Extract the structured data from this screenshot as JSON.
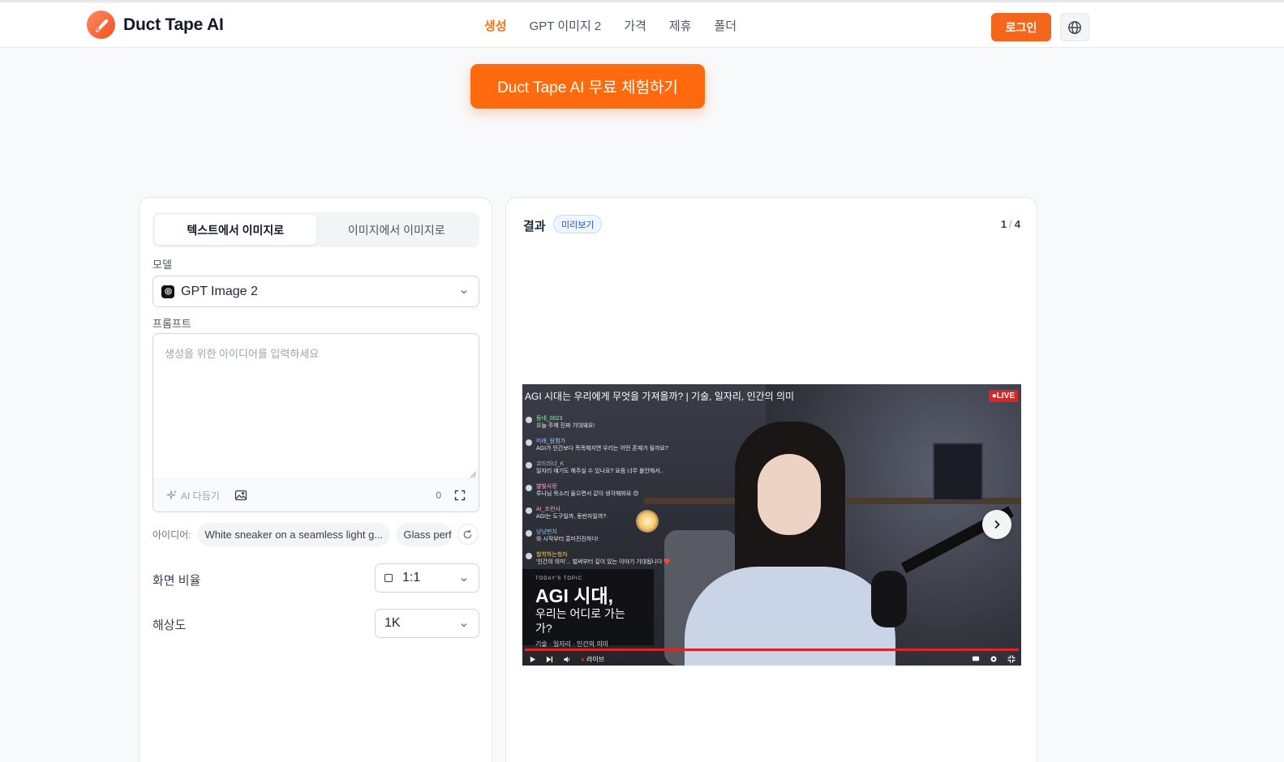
{
  "header": {
    "brand": "Duct Tape AI",
    "nav": [
      "생성",
      "GPT 이미지 2",
      "가격",
      "제휴",
      "폴더"
    ],
    "active_nav": 0,
    "login_label": "로그인",
    "accent_color": "#f97316"
  },
  "cta": {
    "label": "Duct Tape AI 무료 체험하기"
  },
  "generator": {
    "tabs": [
      "텍스트에서 이미지로",
      "이미지에서 이미지로"
    ],
    "active_tab": 0,
    "model_label": "모델",
    "model_value": "GPT Image 2",
    "prompt_label": "프롬프트",
    "prompt_placeholder": "생성을 위한 아이디어를 입력하세요",
    "ai_polish_label": "AI 다듬기",
    "char_count": "0",
    "ideas_label": "아이디어:",
    "ideas": [
      "White sneaker on a seamless light g...",
      "Glass perf"
    ],
    "aspect_label": "화면 비율",
    "aspect_value": "1:1",
    "resolution_label": "해상도",
    "resolution_value": "1K"
  },
  "result": {
    "title": "결과",
    "badge": "미리보기",
    "page_current": "1",
    "page_total": "4",
    "preview": {
      "video_title": "AGI 시대는 우리에게 무엇을 가져올까? | 기술, 일자리, 인간의 의미",
      "live_badge": "●LIVE",
      "chat": [
        {
          "name": "동네_0023",
          "msg": "오늘 주제 진짜 기대돼요!",
          "color": "#86efac"
        },
        {
          "name": "미래_탐험가",
          "msg": "AGI가 인간보다 똑똑해지면 우리는 어떤 존재가 될까요?",
          "color": "#93c5fd"
        },
        {
          "name": "코드러너_K",
          "msg": "일자리 얘기도 해주실 수 있나요? 요즘 너무 불안해서..",
          "color": "#93c5fd"
        },
        {
          "name": "별빛사랑",
          "msg": "루나님 목소리 들으면서 같이 생각해봐요 😊",
          "color": "#f9a8d4"
        },
        {
          "name": "AI_조련사",
          "msg": "AGI는 도구일까, 동반자일까?",
          "color": "#fca5a5"
        },
        {
          "name": "냥냥펀치",
          "msg": "와 시작부터 흥미진진하다!",
          "color": "#93c5fd"
        },
        {
          "name": "철학하는청자",
          "msg": "'인간의 의미'... 벌써부터 깊이 있는 이야기 기대됩니다 ❤️",
          "color": "#fcd34d"
        }
      ],
      "topic_kicker": "TODAY'S TOPIC",
      "topic_head": "AGI 시대,",
      "topic_sub": "우리는 어디로 가는가?",
      "topic_tags": "기술 · 일자리 · 인간의 의미",
      "live_text": "라이브"
    }
  }
}
